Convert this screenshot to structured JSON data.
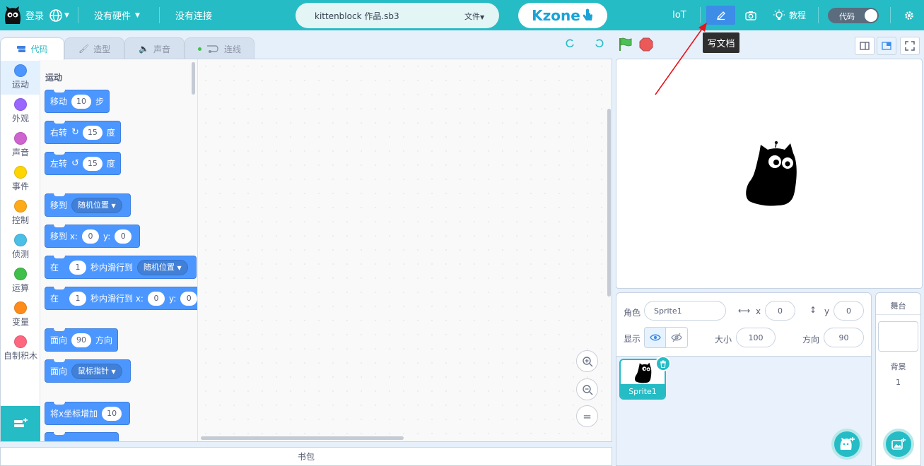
{
  "topbar": {
    "login": "登录",
    "hardware": "没有硬件",
    "connection": "没有连接",
    "project_name": "kittenblock 作品.sb3",
    "file_menu": "文件",
    "kzone": "Kzone",
    "iot": "IoT",
    "tutorial": "教程",
    "code_toggle": "代码",
    "tooltip": "写文档"
  },
  "tabs": [
    "代码",
    "造型",
    "声音",
    "连线"
  ],
  "categories": [
    {
      "label": "运动",
      "color": "#4c97ff"
    },
    {
      "label": "外观",
      "color": "#9966ff"
    },
    {
      "label": "声音",
      "color": "#cf63cf"
    },
    {
      "label": "事件",
      "color": "#ffd500"
    },
    {
      "label": "控制",
      "color": "#ffab19"
    },
    {
      "label": "侦测",
      "color": "#4cbfe6"
    },
    {
      "label": "运算",
      "color": "#40bf4a"
    },
    {
      "label": "变量",
      "color": "#ff8c1a"
    },
    {
      "label": "自制积木",
      "color": "#ff6680"
    }
  ],
  "palette": {
    "heading": "运动",
    "b_move": {
      "a": "移动",
      "n": "10",
      "b": "步"
    },
    "b_right": {
      "a": "右转",
      "n": "15",
      "b": "度"
    },
    "b_left": {
      "a": "左转",
      "n": "15",
      "b": "度"
    },
    "b_goto": {
      "a": "移到",
      "d": "随机位置"
    },
    "b_gotoxy": {
      "a": "移到 x:",
      "x": "0",
      "y_lbl": "y:",
      "y": "0"
    },
    "b_glide": {
      "a": "在",
      "n": "1",
      "b": "秒内滑行到",
      "d": "随机位置"
    },
    "b_glidexy": {
      "a": "在",
      "n": "1",
      "b": "秒内滑行到 x:",
      "x": "0",
      "y_lbl": "y:",
      "y": "0"
    },
    "b_point": {
      "a": "面向",
      "n": "90",
      "b": "方向"
    },
    "b_towards": {
      "a": "面向",
      "d": "鼠标指针"
    },
    "b_changex": {
      "a": "将x坐标增加",
      "n": "10"
    }
  },
  "backpack": "书包",
  "sprite_info": {
    "sprite_label": "角色",
    "sprite_name": "Sprite1",
    "x_label": "x",
    "x": "0",
    "y_label": "y",
    "y": "0",
    "show_label": "显示",
    "size_label": "大小",
    "size": "100",
    "direction_label": "方向",
    "direction": "90"
  },
  "sprites": [
    {
      "name": "Sprite1"
    }
  ],
  "stage_panel": {
    "title": "舞台",
    "backdrops_label": "背景",
    "backdrops_count": "1"
  },
  "colors": {
    "accent": "#26bcc5",
    "motion": "#4c97ff"
  }
}
